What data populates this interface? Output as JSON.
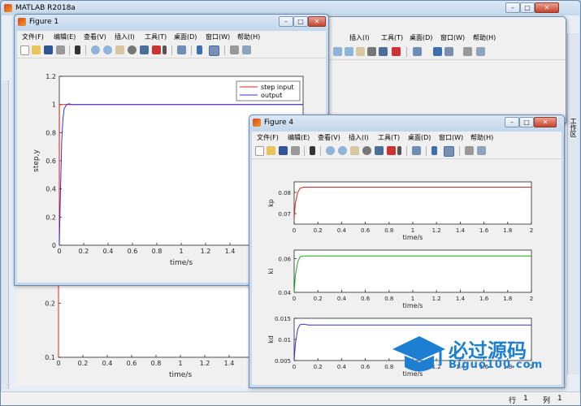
{
  "colors": {
    "red": "#e02020",
    "blue": "#3030e0",
    "green": "#10b010",
    "desktop": "#b9d1ea"
  },
  "matlab": {
    "title": "MATLAB R2018a",
    "menu": [
      "文件(F)",
      "编辑(E)",
      "查看(V)",
      "插入(I)",
      "工具(T)",
      "桌面(D)",
      "窗口(W)",
      "帮助(H)"
    ],
    "side_label": "工作区",
    "status_row": "行",
    "status_row_val": "1",
    "status_col": "列",
    "status_col_val": "1"
  },
  "figure1": {
    "title": "Figure 1",
    "menu": [
      "文件(F)",
      "编辑(E)",
      "查看(V)",
      "插入(I)",
      "工具(T)",
      "桌面(D)",
      "窗口(W)",
      "帮助(H)"
    ]
  },
  "figure4": {
    "title": "Figure 4",
    "menu": [
      "文件(F)",
      "编辑(E)",
      "查看(V)",
      "插入(I)",
      "工具(T)",
      "桌面(D)",
      "窗口(W)",
      "帮助(H)"
    ]
  },
  "watermark": {
    "cn": "必过源码",
    "url": "Biguo100.com"
  },
  "chart_data": [
    {
      "type": "line",
      "name_ref": "figure1",
      "xlabel": "time/s",
      "ylabel": "step,y",
      "xlim": [
        0,
        2
      ],
      "ylim": [
        0,
        1.2
      ],
      "xticks": [
        "0",
        "0.2",
        "0.4",
        "0.6",
        "0.8",
        "1",
        "1.2",
        "1.4"
      ],
      "yticks": [
        "0",
        "0.2",
        "0.4",
        "0.6",
        "0.8",
        "1",
        "1.2"
      ],
      "legend": [
        "step input",
        "output"
      ],
      "series": [
        {
          "name": "step input",
          "x": [
            0,
            0.001,
            2
          ],
          "y": [
            0,
            1,
            1
          ]
        },
        {
          "name": "output",
          "x": [
            0,
            0.01,
            0.02,
            0.03,
            0.04,
            0.06,
            0.08,
            0.1,
            2
          ],
          "y": [
            0,
            0.4,
            0.75,
            0.9,
            0.97,
            1.0,
            1.005,
            1.0,
            1.0
          ]
        }
      ]
    },
    {
      "type": "line",
      "name_ref": "behind",
      "xlabel": "time/s",
      "xlim": [
        0,
        2
      ],
      "ylim": [
        0.1,
        0.25
      ],
      "xticks": [
        "0",
        "0.2",
        "0.4",
        "0.6",
        "0.8",
        "1",
        "1.2",
        "1.4"
      ],
      "yticks": [
        "0.1",
        "0.2"
      ],
      "series": [
        {
          "x": [
            0,
            0,
            0.005
          ],
          "y": [
            0.1,
            0.25,
            0.25
          ]
        }
      ]
    },
    {
      "type": "line",
      "name_ref": "kp",
      "xlabel": "time/s",
      "ylabel": "kp",
      "xlim": [
        0,
        2
      ],
      "ylim": [
        0.065,
        0.085
      ],
      "xticks": [
        "0",
        "0.2",
        "0.4",
        "0.6",
        "0.8",
        "1",
        "1.2",
        "1.4",
        "1.6",
        "1.8",
        "2"
      ],
      "yticks": [
        "0.07",
        "0.08"
      ],
      "series": [
        {
          "x": [
            0,
            0.01,
            0.03,
            0.05,
            0.08,
            2
          ],
          "y": [
            0.068,
            0.075,
            0.08,
            0.082,
            0.0825,
            0.0825
          ]
        }
      ]
    },
    {
      "type": "line",
      "name_ref": "ki",
      "xlabel": "time/s",
      "ylabel": "ki",
      "xlim": [
        0,
        2
      ],
      "ylim": [
        0.04,
        0.065
      ],
      "xticks": [
        "0",
        "0.2",
        "0.4",
        "0.6",
        "0.8",
        "1",
        "1.2",
        "1.4",
        "1.6",
        "1.8",
        "2"
      ],
      "yticks": [
        "0.04",
        "0.06"
      ],
      "series": [
        {
          "x": [
            0,
            0.01,
            0.03,
            0.05,
            0.08,
            2
          ],
          "y": [
            0.04,
            0.05,
            0.058,
            0.061,
            0.0615,
            0.0615
          ]
        }
      ]
    },
    {
      "type": "line",
      "name_ref": "kd",
      "xlabel": "time/s",
      "ylabel": "kd",
      "xlim": [
        0,
        2
      ],
      "ylim": [
        0.005,
        0.015
      ],
      "xticks": [
        "0",
        "0.2",
        "0.4",
        "0.6",
        "0.8",
        "1",
        "1.2",
        "1.4",
        "1.6",
        "1.8",
        "2"
      ],
      "yticks": [
        "0.005",
        "0.01",
        "0.015"
      ],
      "series": [
        {
          "x": [
            0,
            0.01,
            0.03,
            0.05,
            0.08,
            0.12,
            2
          ],
          "y": [
            0.005,
            0.009,
            0.0125,
            0.0135,
            0.0136,
            0.0134,
            0.0134
          ]
        }
      ]
    }
  ]
}
